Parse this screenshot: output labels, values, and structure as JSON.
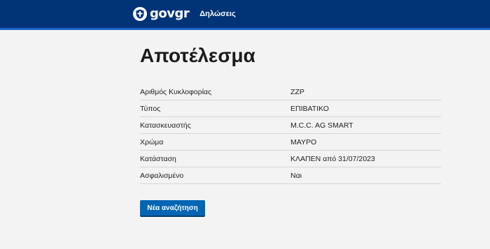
{
  "header": {
    "logo": {
      "gov": "gov",
      "gr": "gr"
    },
    "nav_label": "Δηλώσεις",
    "brand_color": "#003476",
    "accent_color": "#1a63c9"
  },
  "main": {
    "title": "Αποτέλεσμα",
    "rows": [
      {
        "label": "Αριθμός Κυκλοφορίας",
        "value": "ZZP"
      },
      {
        "label": "Τύπος",
        "value": "ΕΠΙΒΑΤΙΚΟ"
      },
      {
        "label": "Κατασκευαστής",
        "value": "M.C.C. AG SMART"
      },
      {
        "label": "Χρώμα",
        "value": "ΜΑΥΡΟ"
      },
      {
        "label": "Κατάσταση",
        "value": "ΚΛΑΠΕΝ από 31/07/2023"
      },
      {
        "label": "Ασφαλισμένο",
        "value": "Ναι"
      }
    ],
    "new_search_label": "Νέα αναζήτηση",
    "button_color": "#0065b3"
  },
  "icons": {
    "emblem": "greek-coat-of-arms-icon"
  }
}
